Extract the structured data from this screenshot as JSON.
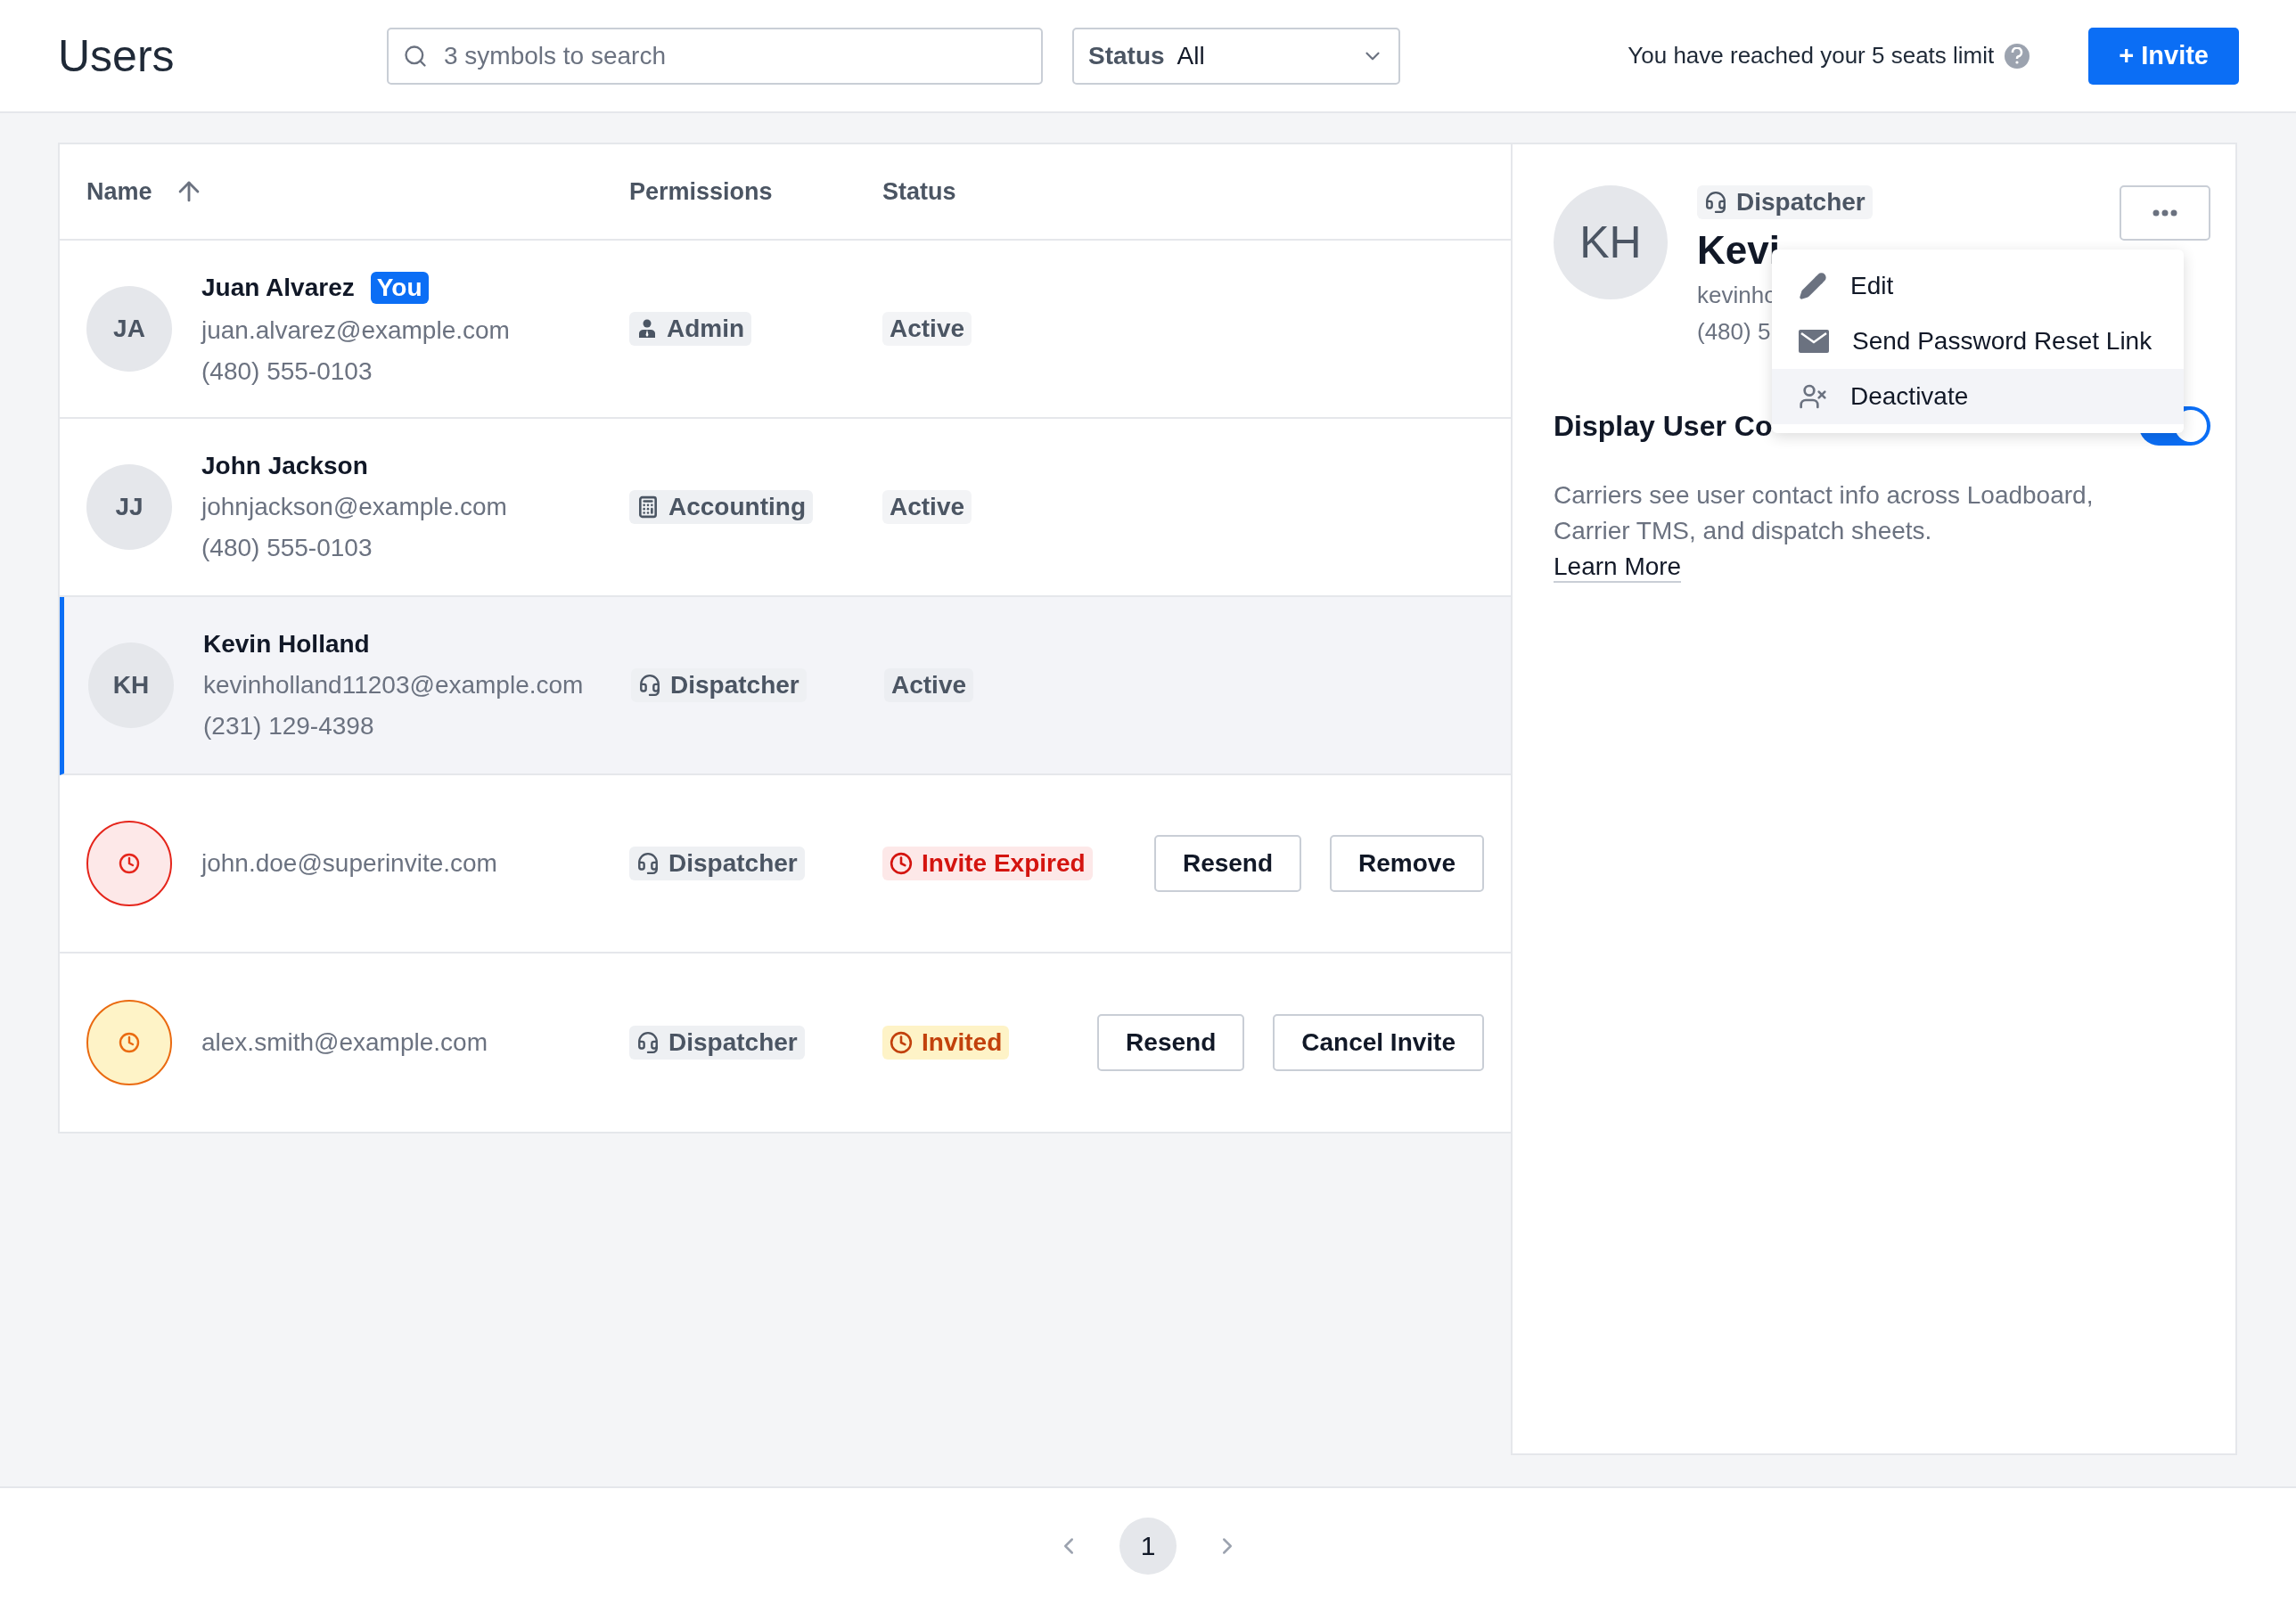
{
  "header": {
    "title": "Users",
    "search": {
      "placeholder": "3 symbols to search"
    },
    "status_filter": {
      "label": "Status",
      "value": "All"
    },
    "seat_notice": "You have reached your 5 seats limit",
    "invite_button": "+ Invite"
  },
  "table": {
    "columns": [
      {
        "label": "Name",
        "sorted_ascending": true
      },
      {
        "label": "Permissions",
        "sorted_ascending": false
      },
      {
        "label": "Status",
        "sorted_ascending": false
      }
    ],
    "rows": [
      {
        "kind": "user",
        "initials": "JA",
        "name": "Juan Alvarez",
        "you_badge": "You",
        "email": "juan.alvarez@example.com",
        "phone": "(480) 555-0103",
        "role": {
          "kind": "admin",
          "label": "Admin"
        },
        "status": {
          "kind": "active",
          "label": "Active"
        },
        "selected": false,
        "actions": []
      },
      {
        "kind": "user",
        "initials": "JJ",
        "name": "John Jackson",
        "email": "johnjackson@example.com",
        "phone": "(480) 555-0103",
        "role": {
          "kind": "accounting",
          "label": "Accounting"
        },
        "status": {
          "kind": "active",
          "label": "Active"
        },
        "selected": false,
        "actions": []
      },
      {
        "kind": "user",
        "initials": "KH",
        "name": "Kevin Holland",
        "email": "kevinholland11203@example.com",
        "phone": "(231) 129-4398",
        "role": {
          "kind": "dispatcher",
          "label": "Dispatcher"
        },
        "status": {
          "kind": "active",
          "label": "Active"
        },
        "selected": true,
        "actions": []
      },
      {
        "kind": "invite",
        "email": "john.doe@superinvite.com",
        "role": {
          "kind": "dispatcher",
          "label": "Dispatcher"
        },
        "status": {
          "kind": "expired",
          "label": "Invite Expired"
        },
        "selected": false,
        "actions": [
          "Resend",
          "Remove"
        ]
      },
      {
        "kind": "invite",
        "email": "alex.smith@example.com",
        "role": {
          "kind": "dispatcher",
          "label": "Dispatcher"
        },
        "status": {
          "kind": "invited",
          "label": "Invited"
        },
        "selected": false,
        "actions": [
          "Resend",
          "Cancel Invite"
        ]
      }
    ]
  },
  "detail": {
    "initials": "KH",
    "role": {
      "kind": "dispatcher",
      "label": "Dispatcher"
    },
    "name": "Kevi",
    "email": "kevinho",
    "phone": "(480) 5",
    "toggle": {
      "label": "Display User Co",
      "on": true
    },
    "description": "Carriers see user contact info across Loadboard, Carrier TMS, and dispatch sheets.",
    "link": "Learn More",
    "menu": {
      "items": [
        {
          "kind": "edit",
          "label": "Edit",
          "highlighted": false
        },
        {
          "kind": "reset",
          "label": "Send Password Reset Link",
          "highlighted": false
        },
        {
          "kind": "deactivate",
          "label": "Deactivate",
          "highlighted": true
        }
      ]
    }
  },
  "pagination": {
    "pages": [
      {
        "label": "1",
        "selected": true
      }
    ]
  }
}
